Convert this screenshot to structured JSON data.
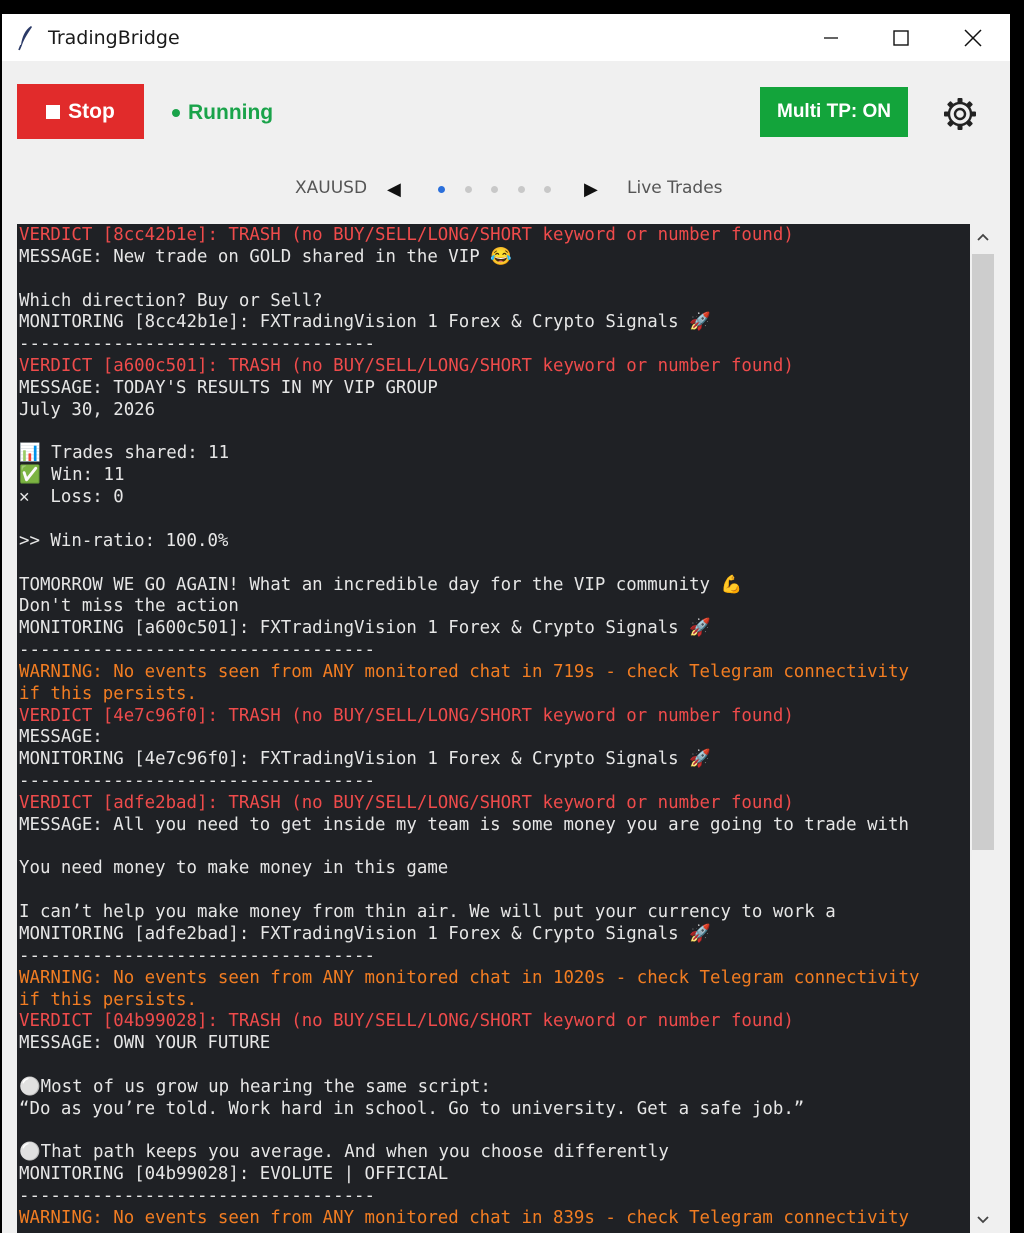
{
  "window": {
    "title": "TradingBridge"
  },
  "toolbar": {
    "stop_label": "Stop",
    "status_label": "Running",
    "multi_tp_label": "Multi TP: ON"
  },
  "pager": {
    "left_label": "XAUUSD",
    "right_label": "Live Trades",
    "dots": 5,
    "active_dot": 0
  },
  "colors": {
    "stop": "#e12b2b",
    "running": "#1aa34a",
    "multi_tp": "#13a43b",
    "log_bg": "#1f2125",
    "verdict": "#ef4b4b",
    "warning": "#f27d22"
  },
  "log": [
    {
      "type": "verdict",
      "text": "VERDICT [8cc42b1e]: TRASH (no BUY/SELL/LONG/SHORT keyword or number found)"
    },
    {
      "type": "normal",
      "text": "MESSAGE: New trade on GOLD shared in the VIP 😂"
    },
    {
      "type": "normal",
      "text": ""
    },
    {
      "type": "normal",
      "text": "Which direction? Buy or Sell?"
    },
    {
      "type": "normal",
      "text": "MONITORING [8cc42b1e]: FXTradingVision 1 Forex & Crypto Signals 🚀"
    },
    {
      "type": "sep",
      "text": "----------------------------------"
    },
    {
      "type": "verdict",
      "text": "VERDICT [a600c501]: TRASH (no BUY/SELL/LONG/SHORT keyword or number found)"
    },
    {
      "type": "normal",
      "text": "MESSAGE: TODAY'S RESULTS IN MY VIP GROUP"
    },
    {
      "type": "normal",
      "text": "July 30, 2026"
    },
    {
      "type": "normal",
      "text": ""
    },
    {
      "type": "normal",
      "text": "📊 Trades shared: 11"
    },
    {
      "type": "normal",
      "text": "✅ Win: 11"
    },
    {
      "type": "normal",
      "text": "✕  Loss: 0"
    },
    {
      "type": "normal",
      "text": ""
    },
    {
      "type": "normal",
      "text": ">> Win-ratio: 100.0%"
    },
    {
      "type": "normal",
      "text": ""
    },
    {
      "type": "normal",
      "text": "TOMORROW WE GO AGAIN! What an incredible day for the VIP community 💪"
    },
    {
      "type": "normal",
      "text": "Don't miss the action"
    },
    {
      "type": "normal",
      "text": "MONITORING [a600c501]: FXTradingVision 1 Forex & Crypto Signals 🚀"
    },
    {
      "type": "sep",
      "text": "----------------------------------"
    },
    {
      "type": "warning",
      "text": "WARNING: No events seen from ANY monitored chat in 719s - check Telegram connectivity"
    },
    {
      "type": "warning",
      "text": "if this persists."
    },
    {
      "type": "verdict",
      "text": "VERDICT [4e7c96f0]: TRASH (no BUY/SELL/LONG/SHORT keyword or number found)"
    },
    {
      "type": "normal",
      "text": "MESSAGE:"
    },
    {
      "type": "normal",
      "text": "MONITORING [4e7c96f0]: FXTradingVision 1 Forex & Crypto Signals 🚀"
    },
    {
      "type": "sep",
      "text": "----------------------------------"
    },
    {
      "type": "verdict",
      "text": "VERDICT [adfe2bad]: TRASH (no BUY/SELL/LONG/SHORT keyword or number found)"
    },
    {
      "type": "normal",
      "text": "MESSAGE: All you need to get inside my team is some money you are going to trade with"
    },
    {
      "type": "normal",
      "text": ""
    },
    {
      "type": "normal",
      "text": "You need money to make money in this game"
    },
    {
      "type": "normal",
      "text": ""
    },
    {
      "type": "normal",
      "text": "I can’t help you make money from thin air. We will put your currency to work a"
    },
    {
      "type": "normal",
      "text": "MONITORING [adfe2bad]: FXTradingVision 1 Forex & Crypto Signals 🚀"
    },
    {
      "type": "sep",
      "text": "----------------------------------"
    },
    {
      "type": "warning",
      "text": "WARNING: No events seen from ANY monitored chat in 1020s - check Telegram connectivity"
    },
    {
      "type": "warning",
      "text": "if this persists."
    },
    {
      "type": "verdict",
      "text": "VERDICT [04b99028]: TRASH (no BUY/SELL/LONG/SHORT keyword or number found)"
    },
    {
      "type": "normal",
      "text": "MESSAGE: OWN YOUR FUTURE"
    },
    {
      "type": "normal",
      "text": ""
    },
    {
      "type": "normal",
      "text": "⚪Most of us grow up hearing the same script:"
    },
    {
      "type": "normal",
      "text": "“Do as you’re told. Work hard in school. Go to university. Get a safe job.”"
    },
    {
      "type": "normal",
      "text": ""
    },
    {
      "type": "normal",
      "text": "⚪That path keeps you average. And when you choose differently"
    },
    {
      "type": "normal",
      "text": "MONITORING [04b99028]: EVOLUTE | OFFICIAL"
    },
    {
      "type": "sep",
      "text": "----------------------------------"
    },
    {
      "type": "warning",
      "text": "WARNING: No events seen from ANY monitored chat in 839s - check Telegram connectivity"
    }
  ]
}
